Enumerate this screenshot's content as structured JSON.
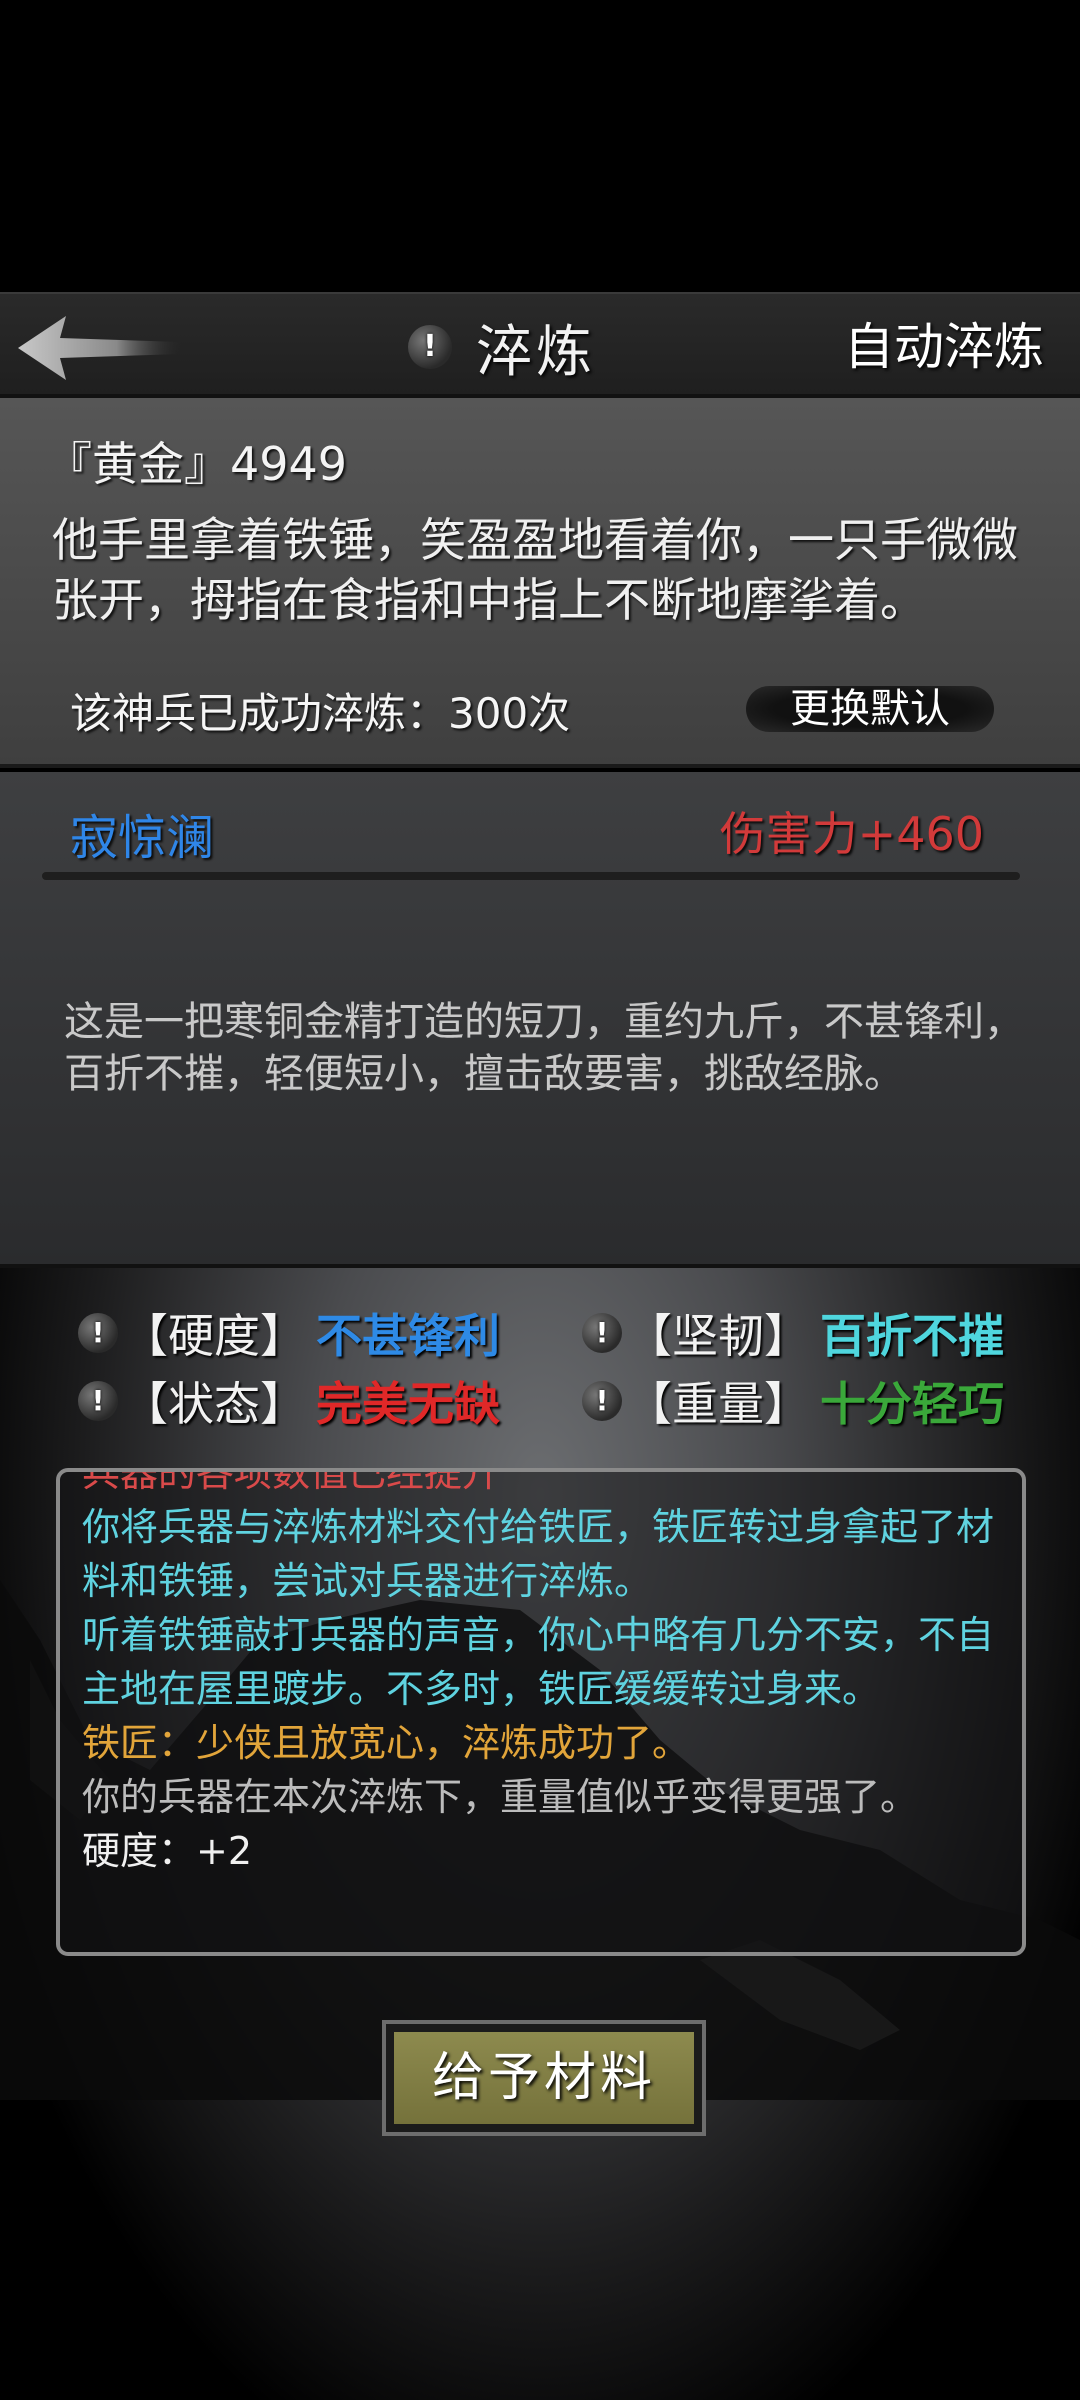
{
  "header": {
    "title": "淬炼",
    "auto_label": "自动淬炼",
    "back_icon": "back-arrow-icon",
    "info_icon_text": "!"
  },
  "item": {
    "name": "『黄金』4949",
    "description": "他手里拿着铁锤，笑盈盈地看着你，一只手微微张开，拇指在食指和中指上不断地摩挲着。",
    "refine_count": "该神兵已成功淬炼：300次",
    "default_button": "更换默认"
  },
  "weapon": {
    "name": "寂惊澜",
    "damage": "伤害力+460",
    "description": "这是一把寒铜金精打造的短刀，重约九斤，不甚锋利，百折不摧，轻便短小，擅击敌要害，挑敌经脉。"
  },
  "stats": [
    {
      "label": "【硬度】",
      "value": "不甚锋利",
      "color": "#2e8ae6"
    },
    {
      "label": "【坚韧】",
      "value": "百折不摧",
      "color": "#4fd6de"
    },
    {
      "label": "【状态】",
      "value": "完美无缺",
      "color": "#e02828"
    },
    {
      "label": "【重量】",
      "value": "十分轻巧",
      "color": "#3aa83a"
    }
  ],
  "log": [
    {
      "text": "兵器的各项数值已经提升",
      "color": "#d94a4a"
    },
    {
      "text": "你将兵器与淬炼材料交付给铁匠，铁匠转过身拿起了材料和铁锤，尝试对兵器进行淬炼。",
      "color": "#5fd3e0"
    },
    {
      "text": "听着铁锤敲打兵器的声音，你心中略有几分不安，不自主地在屋里踱步。不多时，铁匠缓缓转过身来。",
      "color": "#5fd3e0"
    },
    {
      "text": "铁匠：少侠且放宽心，淬炼成功了。",
      "color": "#e2a53a"
    },
    {
      "text": "你的兵器在本次淬炼下，重量值似乎变得更强了。",
      "color": "#bcbcbc"
    },
    {
      "text": "硬度：+2",
      "color": "#f0f0f0"
    }
  ],
  "give_button": "给予材料"
}
